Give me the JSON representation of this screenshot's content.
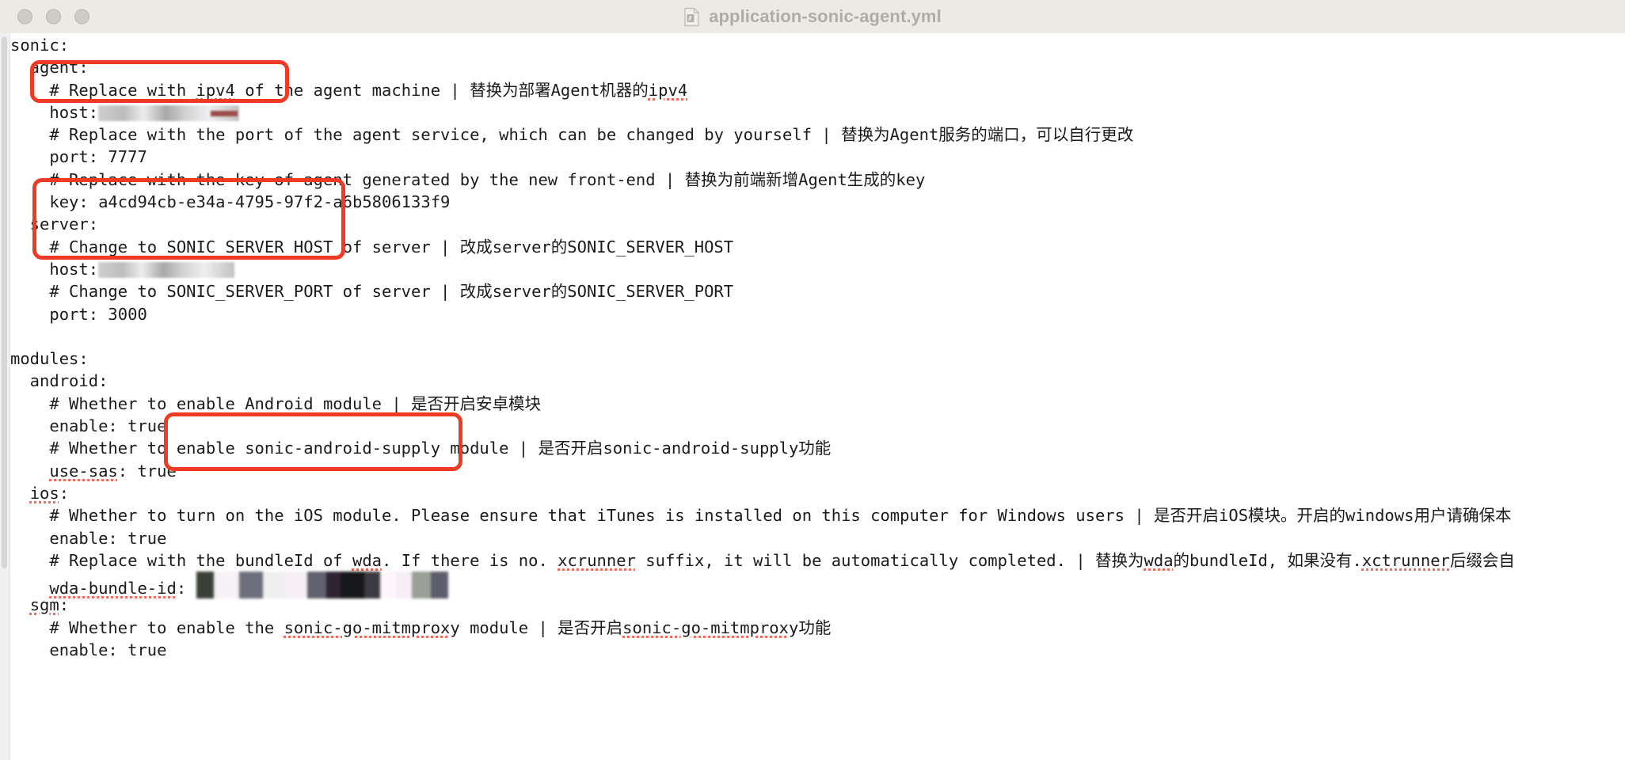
{
  "window": {
    "title": "application-sonic-agent.yml",
    "file_icon": "yaml-document-icon",
    "traffic_lights": [
      "close-button",
      "minimize-button",
      "zoom-button"
    ]
  },
  "editor": {
    "language": "yaml",
    "redaction_placeholder": "████████",
    "lines": [
      {
        "id": 1,
        "text": "sonic:"
      },
      {
        "id": 2,
        "text": "  agent:"
      },
      {
        "id": 3,
        "text": "    # Replace with ipv4 of the agent machine | 替换为部署Agent机器的ipv4"
      },
      {
        "id": 4,
        "text": "    host: "
      },
      {
        "id": 5,
        "text": "    # Replace with the port of the agent service, which can be changed by yourself | 替换为Agent服务的端口，可以自行更改"
      },
      {
        "id": 6,
        "text": "    port: 7777"
      },
      {
        "id": 7,
        "text": "    # Replace with the key of agent generated by the new front-end | 替换为前端新增Agent生成的key"
      },
      {
        "id": 8,
        "text": "    key: a4cd94cb-e34a-4795-97f2-a6b5806133f9"
      },
      {
        "id": 9,
        "text": "  server:"
      },
      {
        "id": 10,
        "text": "    # Change to SONIC_SERVER_HOST of server | 改成server的SONIC_SERVER_HOST"
      },
      {
        "id": 11,
        "text": "    host: "
      },
      {
        "id": 12,
        "text": "    # Change to SONIC_SERVER_PORT of server | 改成server的SONIC_SERVER_PORT"
      },
      {
        "id": 13,
        "text": "    port: 3000"
      },
      {
        "id": 14,
        "text": ""
      },
      {
        "id": 15,
        "text": "modules:"
      },
      {
        "id": 16,
        "text": "  android:"
      },
      {
        "id": 17,
        "text": "    # Whether to enable Android module | 是否开启安卓模块"
      },
      {
        "id": 18,
        "text": "    enable: true"
      },
      {
        "id": 19,
        "text": "    # Whether to enable sonic-android-supply module | 是否开启sonic-android-supply功能"
      },
      {
        "id": 20,
        "text": "    use-sas: true"
      },
      {
        "id": 21,
        "text": "  ios:"
      },
      {
        "id": 22,
        "text": "    # Whether to turn on the iOS module. Please ensure that iTunes is installed on this computer for Windows users | 是否开启iOS模块。开启的windows用户请确保本"
      },
      {
        "id": 23,
        "text": "    enable: true"
      },
      {
        "id": 24,
        "text": "    # Replace with the bundleId of wda. If there is no. xcrunner suffix, it will be automatically completed. | 替换为wda的bundleId, 如果没有.xctrunner后缀会自"
      },
      {
        "id": 25,
        "text": "    wda-bundle-id: "
      },
      {
        "id": 26,
        "text": "  sgm:"
      },
      {
        "id": 27,
        "text": "    # Whether to enable the sonic-go-mitmproxy module | 是否开启sonic-go-mitmproxy功能"
      },
      {
        "id": 28,
        "text": "    enable: true"
      }
    ],
    "tokens": {
      "l3_a": "    # Replace with ",
      "l3_sq": "ipv4",
      "l3_b": " of the agent machine | 替换为部署Agent机器的",
      "l3_sq2": "ipv4",
      "l4_key": "    host:",
      "l5": "    # Replace with the port of the agent service, which can be changed by yourself | 替换为Agent服务的端口，可以自行更改",
      "l6": "    port: 7777",
      "l7": "    # Replace with the key of agent generated by the new front-end | 替换为前端新增Agent生成的key",
      "l8": "    key: a4cd94cb-e34a-4795-97f2-a6b5806133f9",
      "l9": "  server:",
      "l10": "    # Change to SONIC_SERVER_HOST of server | 改成server的SONIC_SERVER_HOST",
      "l11_key": "    host:",
      "l12": "    # Change to SONIC_SERVER_PORT of server | 改成server的SONIC_SERVER_PORT",
      "l13": "    port: 3000",
      "l15": "modules:",
      "l16": "  android:",
      "l17": "    # Whether to enable Android module | 是否开启安卓模块",
      "l18": "    enable: true",
      "l19": "    # Whether to enable sonic-android-supply module | 是否开启sonic-android-supply功能",
      "l20_sq": "use-sas",
      "l20_b": ": true",
      "l21_a": "  ",
      "l21_sq": "ios",
      "l21_b": ":",
      "l22": "    # Whether to turn on the iOS module. Please ensure that iTunes is installed on this computer for Windows users | 是否开启iOS模块。开启的windows用户请确保本",
      "l23": "    enable: true",
      "l24_a": "    # Replace with the bundleId of ",
      "l24_sq1": "wda",
      "l24_b": ". If there is no. ",
      "l24_sq2": "xcrunner",
      "l24_c": " suffix, it will be automatically completed. | 替换为",
      "l24_sq3": "wda",
      "l24_d": "的bundleId, 如果没有.",
      "l24_sq4": "xctrunner",
      "l24_e": "后缀会自",
      "l25_a": "    ",
      "l25_sq": "wda-bundle-id",
      "l25_b": ": ",
      "l26_a": "  ",
      "l26_sq": "sgm",
      "l26_b": ":",
      "l27_a": "    # Whether to enable the ",
      "l27_sq1": "sonic-go-mitmproxy",
      "l27_b": " module | 是否开启",
      "l27_sq2": "sonic-go-mitmproxy",
      "l27_c": "功能",
      "l28": "    enable: true"
    }
  },
  "annotations": {
    "accent_color": "#ef3b23",
    "boxes": [
      {
        "name": "agent-host-highlight",
        "target": "sonic.agent.host"
      },
      {
        "name": "server-host-port-highlight",
        "target": "sonic.server"
      },
      {
        "name": "wda-bundle-id-highlight",
        "target": "modules.ios.wda-bundle-id"
      }
    ]
  },
  "colors": {
    "titlebar_bg": "#edeae6",
    "title_text": "#b0aba5",
    "code_text": "#1b1b1b",
    "spellcheck": "#f26a5a",
    "editor_bg": "#ffffff"
  }
}
